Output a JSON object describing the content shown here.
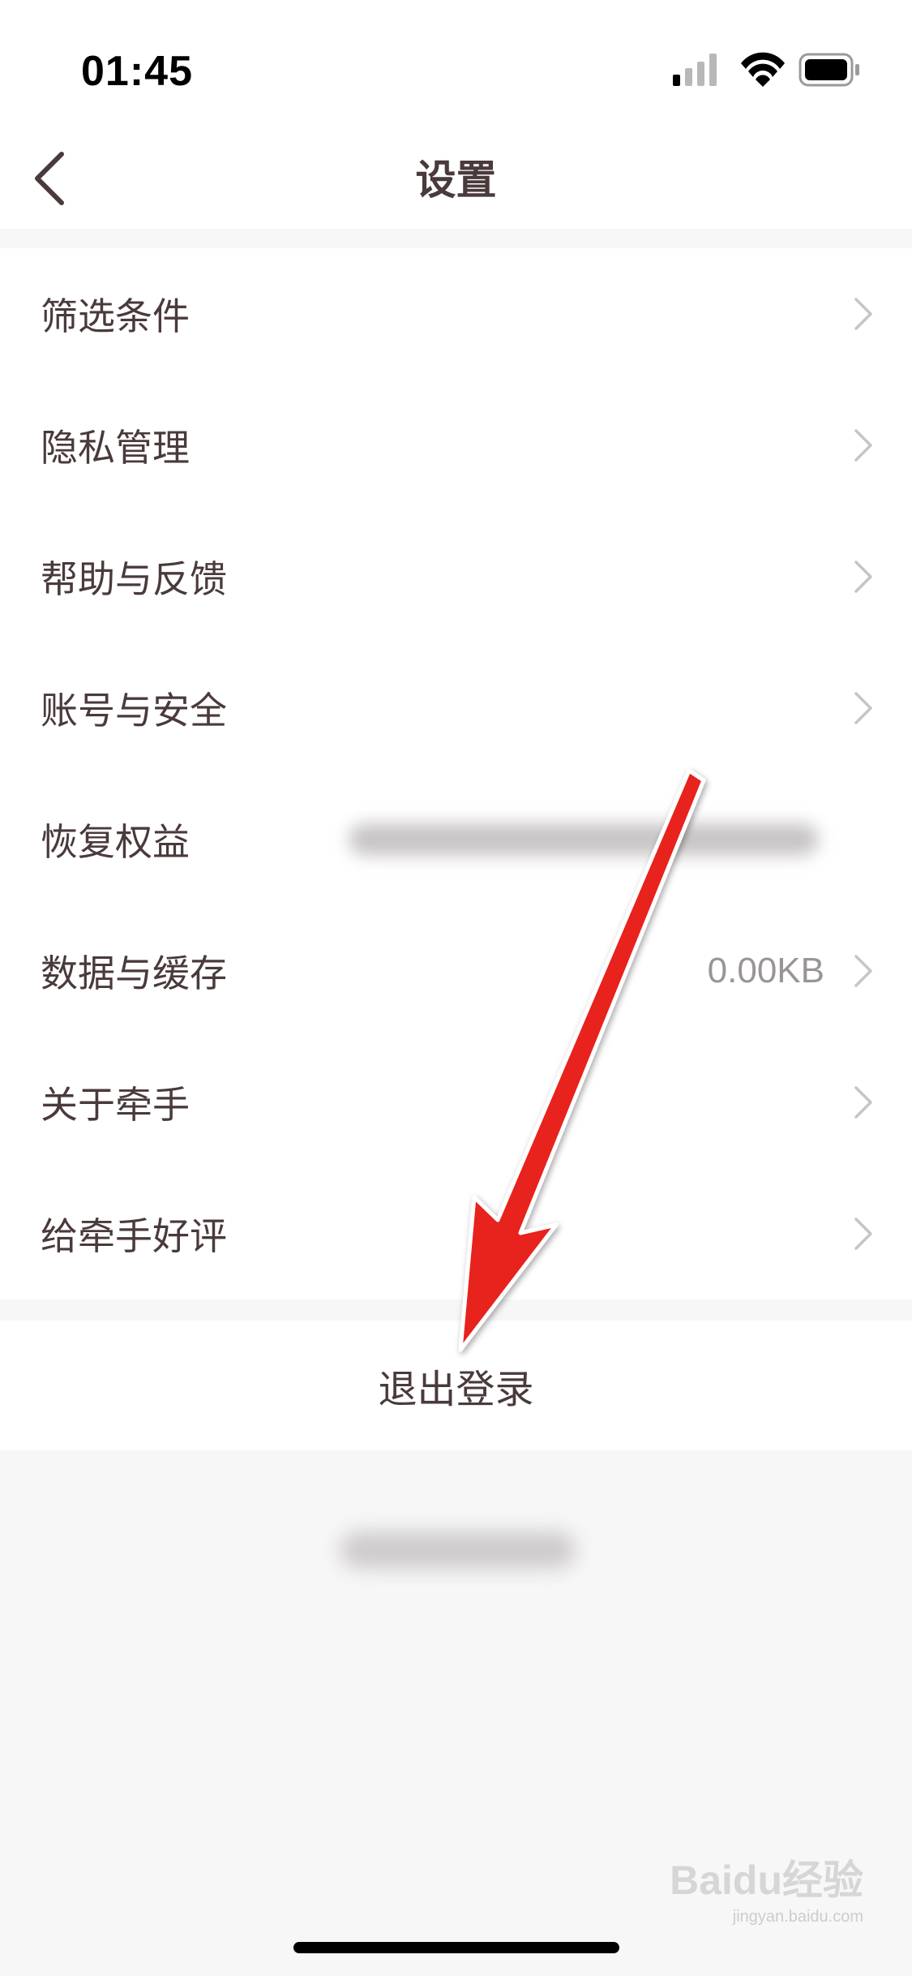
{
  "status_bar": {
    "time": "01:45",
    "signal_icon": "cellular-signal-icon",
    "wifi_icon": "wifi-icon",
    "battery_icon": "battery-icon"
  },
  "nav": {
    "back_icon": "chevron-left-icon",
    "title": "设置"
  },
  "settings": {
    "items": [
      {
        "label": "筛选条件",
        "value": "",
        "chevron": true
      },
      {
        "label": "隐私管理",
        "value": "",
        "chevron": true
      },
      {
        "label": "帮助与反馈",
        "value": "",
        "chevron": true
      },
      {
        "label": "账号与安全",
        "value": "",
        "chevron": true
      },
      {
        "label": "恢复权益",
        "value": "",
        "chevron": false
      },
      {
        "label": "数据与缓存",
        "value": "0.00KB",
        "chevron": true
      },
      {
        "label": "关于牵手",
        "value": "",
        "chevron": true
      },
      {
        "label": "给牵手好评",
        "value": "",
        "chevron": true
      }
    ]
  },
  "logout": {
    "label": "退出登录"
  },
  "watermark": {
    "brand": "Baidu经验",
    "url": "jingyan.baidu.com"
  },
  "colors": {
    "text": "#4a3a3b",
    "muted": "#9a9495",
    "chevron": "#c8c4c5",
    "background": "#f7f7f7",
    "arrow": "#e8211e"
  }
}
